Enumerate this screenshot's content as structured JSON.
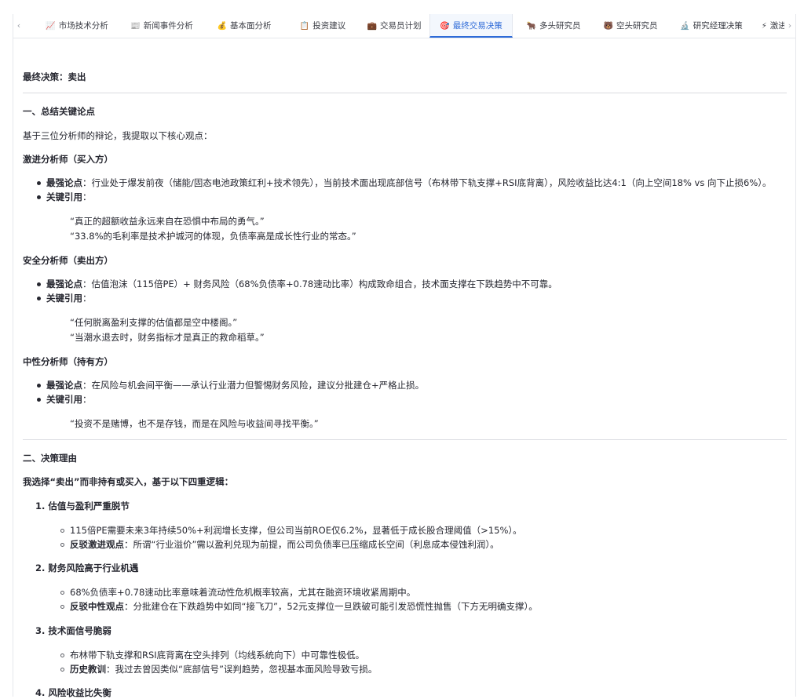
{
  "tabs": [
    {
      "icon": "📈",
      "label": "市场技术分析"
    },
    {
      "icon": "📰",
      "label": "新闻事件分析"
    },
    {
      "icon": "💰",
      "label": "基本面分析"
    },
    {
      "icon": "📋",
      "label": "投资建议"
    },
    {
      "icon": "💼",
      "label": "交易员计划"
    },
    {
      "icon": "🎯",
      "label": "最终交易决策"
    },
    {
      "icon": "🐂",
      "label": "多头研究员"
    },
    {
      "icon": "🐻",
      "label": "空头研究员"
    },
    {
      "icon": "🔬",
      "label": "研究经理决策"
    },
    {
      "icon": "⚡",
      "label": "激进分"
    }
  ],
  "doc": {
    "final_decision": "最终决策：卖出",
    "section1_title": "一、总结关键论点",
    "section1_intro": "基于三位分析师的辩论，我提取以下核心观点：",
    "aggressive": {
      "title": "激进分析师（买入方）",
      "strong_label": "最强论点",
      "strong_text": "：行业处于爆发前夜（储能/固态电池政策红利+技术领先），当前技术面出现底部信号（布林带下轨支撑+RSI底背离），风险收益比达4:1（向上空间18% vs 向下止损6%）。",
      "quote_label": "关键引用",
      "quote_colon": "：",
      "quote1": "“真正的超额收益永远来自在恐惧中布局的勇气。”",
      "quote2": "“33.8%的毛利率是技术护城河的体现，负债率高是成长性行业的常态。”"
    },
    "safe": {
      "title": "安全分析师（卖出方）",
      "strong_label": "最强论点",
      "strong_text": "：估值泡沫（115倍PE）+ 财务风险（68%负债率+0.78速动比率）构成致命组合，技术面支撑在下跌趋势中不可靠。",
      "quote_label": "关键引用",
      "quote_colon": "：",
      "quote1": "“任何脱离盈利支撑的估值都是空中楼阁。”",
      "quote2": "“当潮水退去时，财务指标才是真正的救命稻草。”"
    },
    "neutral": {
      "title": "中性分析师（持有方）",
      "strong_label": "最强论点",
      "strong_text": "：在风险与机会间平衡——承认行业潜力但警惕财务风险，建议分批建仓+严格止损。",
      "quote_label": "关键引用",
      "quote_colon": "：",
      "quote1": "“投资不是赌博，也不是存钱，而是在风险与收益间寻找平衡。”"
    },
    "section2_title": "二、决策理由",
    "section2_intro": "我选择“卖出”而非持有或买入，基于以下四重逻辑：",
    "reasons": [
      {
        "num": "1.",
        "title": "估值与盈利严重脱节",
        "sub1": "115倍PE需要未来3年持续50%+利润增长支撑，但公司当前ROE仅6.2%，显著低于成长股合理阈值（>15%）。",
        "sub2_label": "反驳激进观点",
        "sub2_text": "：所谓“行业溢价”需以盈利兑现为前提，而公司负债率已压缩成长空间（利息成本侵蚀利润）。"
      },
      {
        "num": "2.",
        "title": "财务风险高于行业机遇",
        "sub1": "68%负债率+0.78速动比率意味着流动性危机概率较高，尤其在融资环境收紧周期中。",
        "sub2_label": "反驳中性观点",
        "sub2_text": "：分批建仓在下跌趋势中如同“接飞刀”，52元支撑位一旦跌破可能引发恐慌性抛售（下方无明确支撑）。"
      },
      {
        "num": "3.",
        "title": "技术面信号脆弱",
        "sub1": "布林带下轨支撑和RSI底背离在空头排列（均线系统向下）中可靠性极低。",
        "sub2_label": "历史教训",
        "sub2_text": "：我过去曾因类似“底部信号”误判趋势，忽视基本面风险导致亏损。"
      },
      {
        "num": "4.",
        "title": "风险收益比失衡"
      }
    ]
  }
}
